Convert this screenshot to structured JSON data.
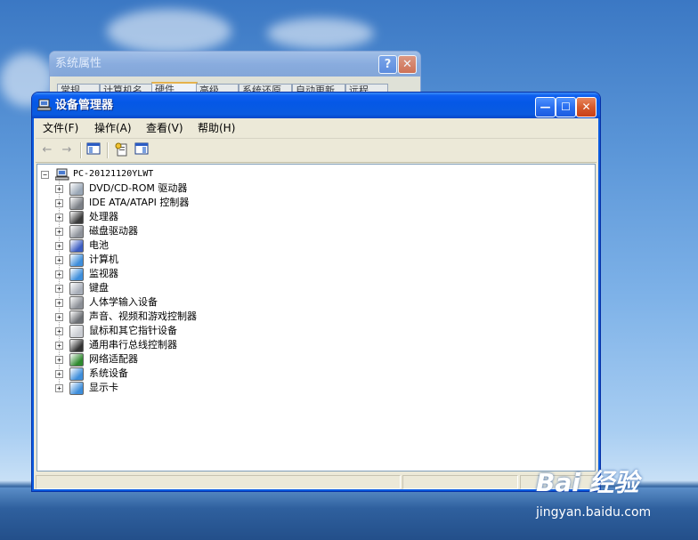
{
  "back_window": {
    "title": "系统属性",
    "tabs": [
      "常规",
      "计算机名",
      "硬件",
      "高级",
      "系统还原",
      "自动更新",
      "远程"
    ],
    "help_label": "?",
    "close_label": "✕"
  },
  "window": {
    "title": "设备管理器",
    "minimize_label": "—",
    "maximize_label": "☐",
    "close_label": "✕"
  },
  "menu": [
    "文件(F)",
    "操作(A)",
    "查看(V)",
    "帮助(H)"
  ],
  "toolbar": {
    "back_icon": "←",
    "forward_icon": "→",
    "icons": [
      "show-hide-console-tree-icon",
      "properties-icon",
      "help-icon"
    ]
  },
  "tree": {
    "root": "PC-20121120YLWT",
    "root_toggle": "−",
    "child_toggle": "+",
    "items": [
      {
        "label": "DVD/CD-ROM 驱动器",
        "icon": "cdrom-icon",
        "color": "#9aa7b6"
      },
      {
        "label": "IDE ATA/ATAPI 控制器",
        "icon": "ide-controller-icon",
        "color": "#7b7f86"
      },
      {
        "label": "处理器",
        "icon": "processor-icon",
        "color": "#3b3b3b"
      },
      {
        "label": "磁盘驱动器",
        "icon": "disk-drive-icon",
        "color": "#8d9199"
      },
      {
        "label": "电池",
        "icon": "battery-icon",
        "color": "#3c5dc2"
      },
      {
        "label": "计算机",
        "icon": "computer-icon",
        "color": "#3e8edb"
      },
      {
        "label": "监视器",
        "icon": "monitor-icon",
        "color": "#3e8edb"
      },
      {
        "label": "键盘",
        "icon": "keyboard-icon",
        "color": "#a7adb8"
      },
      {
        "label": "人体学输入设备",
        "icon": "hid-icon",
        "color": "#8b8f96"
      },
      {
        "label": "声音、视频和游戏控制器",
        "icon": "sound-icon",
        "color": "#6c6f74"
      },
      {
        "label": "鼠标和其它指针设备",
        "icon": "mouse-icon",
        "color": "#c9ccd2"
      },
      {
        "label": "通用串行总线控制器",
        "icon": "usb-icon",
        "color": "#333333"
      },
      {
        "label": "网络适配器",
        "icon": "network-adapter-icon",
        "color": "#2f8a2f"
      },
      {
        "label": "系统设备",
        "icon": "system-device-icon",
        "color": "#3e8edb"
      },
      {
        "label": "显示卡",
        "icon": "display-adapter-icon",
        "color": "#3e8edb"
      }
    ]
  },
  "watermark": {
    "logo": "Bai 经验",
    "url": "jingyan.baidu.com"
  }
}
